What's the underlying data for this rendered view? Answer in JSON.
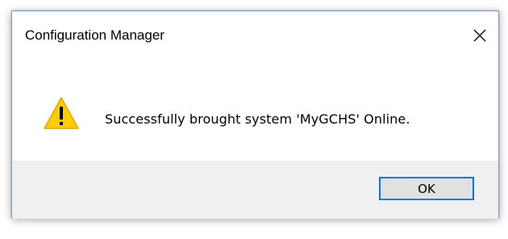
{
  "window": {
    "title": "Configuration Manager",
    "close_icon": "close-icon"
  },
  "message": {
    "icon": "warning-icon",
    "icon_color": "#ffcc00",
    "text": "Successfully brought system 'MyGCHS' Online."
  },
  "footer": {
    "ok_label": "OK",
    "button_accent": "#0078d7"
  }
}
